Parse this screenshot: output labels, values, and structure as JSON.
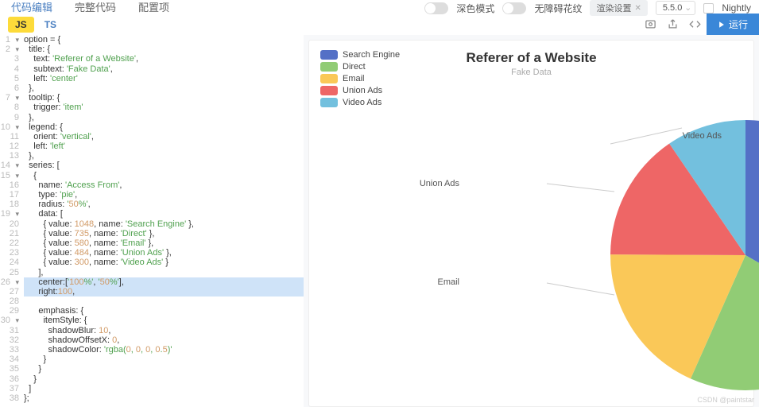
{
  "tabs": {
    "edit": "代码编辑",
    "full": "完整代码",
    "config": "配置项"
  },
  "ctrls": {
    "dark": "深色模式",
    "a11y": "无障碍花纹",
    "render": "渲染设置",
    "version": "5.5.0",
    "nightly": "Nightly"
  },
  "lang": {
    "js": "JS",
    "ts": "TS"
  },
  "run": "运行",
  "lines": [
    "option = {",
    "  title: {",
    "    text: 'Referer of a Website',",
    "    subtext: 'Fake Data',",
    "    left: 'center'",
    "  },",
    "  tooltip: {",
    "    trigger: 'item'",
    "  },",
    "  legend: {",
    "    orient: 'vertical',",
    "    left: 'left'",
    "  },",
    "  series: [",
    "    {",
    "      name: 'Access From',",
    "      type: 'pie',",
    "      radius: '50%',",
    "      data: [",
    "        { value: 1048, name: 'Search Engine' },",
    "        { value: 735, name: 'Direct' },",
    "        { value: 580, name: 'Email' },",
    "        { value: 484, name: 'Union Ads' },",
    "        { value: 300, name: 'Video Ads' }",
    "      ],",
    "      center:['100%', '50%'],",
    "      right:100,",
    "",
    "      emphasis: {",
    "        itemStyle: {",
    "          shadowBlur: 10,",
    "          shadowOffsetX: 0,",
    "          shadowColor: 'rgba(0, 0, 0, 0.5)'",
    "        }",
    "      }",
    "    }",
    "  ]",
    "};"
  ],
  "chart_data": {
    "type": "pie",
    "title": "Referer of a Website",
    "subtitle": "Fake Data",
    "series": [
      {
        "name": "Search Engine",
        "value": 1048,
        "color": "#5470c6"
      },
      {
        "name": "Direct",
        "value": 735,
        "color": "#91cc75"
      },
      {
        "name": "Email",
        "value": 580,
        "color": "#fac858"
      },
      {
        "name": "Union Ads",
        "value": 484,
        "color": "#ee6666"
      },
      {
        "name": "Video Ads",
        "value": 300,
        "color": "#73c0de"
      }
    ],
    "visible_labels": [
      "Video Ads",
      "Union Ads",
      "Email"
    ]
  },
  "watermark": "CSDN @paintstar"
}
